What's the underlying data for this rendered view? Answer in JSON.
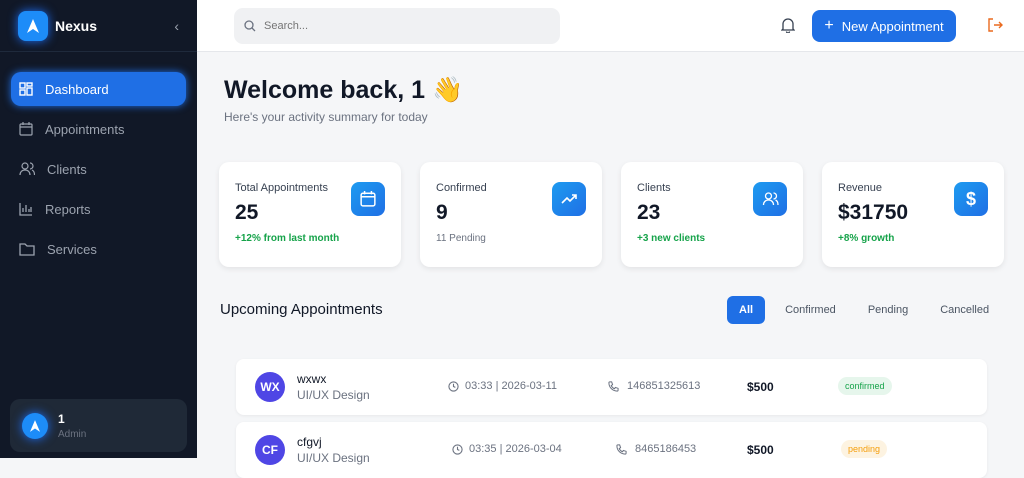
{
  "brand": {
    "name": "Nexus"
  },
  "sidebar": {
    "items": [
      {
        "label": "Dashboard"
      },
      {
        "label": "Appointments"
      },
      {
        "label": "Clients"
      },
      {
        "label": "Reports"
      },
      {
        "label": "Services"
      }
    ]
  },
  "user": {
    "name": "1",
    "role": "Admin"
  },
  "topbar": {
    "search_placeholder": "Search...",
    "new_label": "New Appointment"
  },
  "welcome": {
    "title": "Welcome back, 1 👋",
    "subtitle": "Here's your activity summary for today"
  },
  "stats": [
    {
      "label": "Total Appointments",
      "value": "25",
      "note": "+12% from last month"
    },
    {
      "label": "Confirmed",
      "value": "9",
      "note": "11 Pending"
    },
    {
      "label": "Clients",
      "value": "23",
      "note": "+3 new clients"
    },
    {
      "label": "Revenue",
      "value": "$31750",
      "note": "+8% growth"
    }
  ],
  "upcoming": {
    "title": "Upcoming Appointments",
    "filters": [
      "All",
      "Confirmed",
      "Pending",
      "Cancelled"
    ],
    "rows": [
      {
        "initials": "WX",
        "name": "wxwx",
        "service": "UI/UX Design",
        "time": "03:33 | 2026-03-11",
        "phone": "146851325613",
        "price": "$500",
        "status": "confirmed"
      },
      {
        "initials": "CF",
        "name": "cfgvj",
        "service": "UI/UX Design",
        "time": "03:35 | 2026-03-04",
        "phone": "8465186453",
        "price": "$500",
        "status": "pending"
      }
    ]
  },
  "colors": {
    "accent": "#1f6fe5",
    "confirmed_bg": "#e6f6ec",
    "confirmed_fg": "#16a34a",
    "pending_bg": "#fdf3e1",
    "pending_fg": "#f59e0b"
  }
}
